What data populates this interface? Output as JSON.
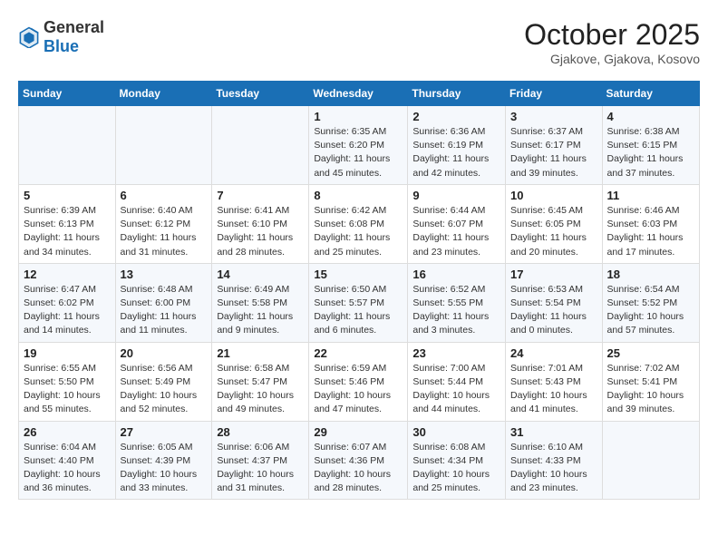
{
  "logo": {
    "text_general": "General",
    "text_blue": "Blue"
  },
  "title": "October 2025",
  "location": "Gjakove, Gjakova, Kosovo",
  "days_of_week": [
    "Sunday",
    "Monday",
    "Tuesday",
    "Wednesday",
    "Thursday",
    "Friday",
    "Saturday"
  ],
  "weeks": [
    [
      {
        "day": "",
        "info": ""
      },
      {
        "day": "",
        "info": ""
      },
      {
        "day": "",
        "info": ""
      },
      {
        "day": "1",
        "info": "Sunrise: 6:35 AM\nSunset: 6:20 PM\nDaylight: 11 hours\nand 45 minutes."
      },
      {
        "day": "2",
        "info": "Sunrise: 6:36 AM\nSunset: 6:19 PM\nDaylight: 11 hours\nand 42 minutes."
      },
      {
        "day": "3",
        "info": "Sunrise: 6:37 AM\nSunset: 6:17 PM\nDaylight: 11 hours\nand 39 minutes."
      },
      {
        "day": "4",
        "info": "Sunrise: 6:38 AM\nSunset: 6:15 PM\nDaylight: 11 hours\nand 37 minutes."
      }
    ],
    [
      {
        "day": "5",
        "info": "Sunrise: 6:39 AM\nSunset: 6:13 PM\nDaylight: 11 hours\nand 34 minutes."
      },
      {
        "day": "6",
        "info": "Sunrise: 6:40 AM\nSunset: 6:12 PM\nDaylight: 11 hours\nand 31 minutes."
      },
      {
        "day": "7",
        "info": "Sunrise: 6:41 AM\nSunset: 6:10 PM\nDaylight: 11 hours\nand 28 minutes."
      },
      {
        "day": "8",
        "info": "Sunrise: 6:42 AM\nSunset: 6:08 PM\nDaylight: 11 hours\nand 25 minutes."
      },
      {
        "day": "9",
        "info": "Sunrise: 6:44 AM\nSunset: 6:07 PM\nDaylight: 11 hours\nand 23 minutes."
      },
      {
        "day": "10",
        "info": "Sunrise: 6:45 AM\nSunset: 6:05 PM\nDaylight: 11 hours\nand 20 minutes."
      },
      {
        "day": "11",
        "info": "Sunrise: 6:46 AM\nSunset: 6:03 PM\nDaylight: 11 hours\nand 17 minutes."
      }
    ],
    [
      {
        "day": "12",
        "info": "Sunrise: 6:47 AM\nSunset: 6:02 PM\nDaylight: 11 hours\nand 14 minutes."
      },
      {
        "day": "13",
        "info": "Sunrise: 6:48 AM\nSunset: 6:00 PM\nDaylight: 11 hours\nand 11 minutes."
      },
      {
        "day": "14",
        "info": "Sunrise: 6:49 AM\nSunset: 5:58 PM\nDaylight: 11 hours\nand 9 minutes."
      },
      {
        "day": "15",
        "info": "Sunrise: 6:50 AM\nSunset: 5:57 PM\nDaylight: 11 hours\nand 6 minutes."
      },
      {
        "day": "16",
        "info": "Sunrise: 6:52 AM\nSunset: 5:55 PM\nDaylight: 11 hours\nand 3 minutes."
      },
      {
        "day": "17",
        "info": "Sunrise: 6:53 AM\nSunset: 5:54 PM\nDaylight: 11 hours\nand 0 minutes."
      },
      {
        "day": "18",
        "info": "Sunrise: 6:54 AM\nSunset: 5:52 PM\nDaylight: 10 hours\nand 57 minutes."
      }
    ],
    [
      {
        "day": "19",
        "info": "Sunrise: 6:55 AM\nSunset: 5:50 PM\nDaylight: 10 hours\nand 55 minutes."
      },
      {
        "day": "20",
        "info": "Sunrise: 6:56 AM\nSunset: 5:49 PM\nDaylight: 10 hours\nand 52 minutes."
      },
      {
        "day": "21",
        "info": "Sunrise: 6:58 AM\nSunset: 5:47 PM\nDaylight: 10 hours\nand 49 minutes."
      },
      {
        "day": "22",
        "info": "Sunrise: 6:59 AM\nSunset: 5:46 PM\nDaylight: 10 hours\nand 47 minutes."
      },
      {
        "day": "23",
        "info": "Sunrise: 7:00 AM\nSunset: 5:44 PM\nDaylight: 10 hours\nand 44 minutes."
      },
      {
        "day": "24",
        "info": "Sunrise: 7:01 AM\nSunset: 5:43 PM\nDaylight: 10 hours\nand 41 minutes."
      },
      {
        "day": "25",
        "info": "Sunrise: 7:02 AM\nSunset: 5:41 PM\nDaylight: 10 hours\nand 39 minutes."
      }
    ],
    [
      {
        "day": "26",
        "info": "Sunrise: 6:04 AM\nSunset: 4:40 PM\nDaylight: 10 hours\nand 36 minutes."
      },
      {
        "day": "27",
        "info": "Sunrise: 6:05 AM\nSunset: 4:39 PM\nDaylight: 10 hours\nand 33 minutes."
      },
      {
        "day": "28",
        "info": "Sunrise: 6:06 AM\nSunset: 4:37 PM\nDaylight: 10 hours\nand 31 minutes."
      },
      {
        "day": "29",
        "info": "Sunrise: 6:07 AM\nSunset: 4:36 PM\nDaylight: 10 hours\nand 28 minutes."
      },
      {
        "day": "30",
        "info": "Sunrise: 6:08 AM\nSunset: 4:34 PM\nDaylight: 10 hours\nand 25 minutes."
      },
      {
        "day": "31",
        "info": "Sunrise: 6:10 AM\nSunset: 4:33 PM\nDaylight: 10 hours\nand 23 minutes."
      },
      {
        "day": "",
        "info": ""
      }
    ]
  ]
}
